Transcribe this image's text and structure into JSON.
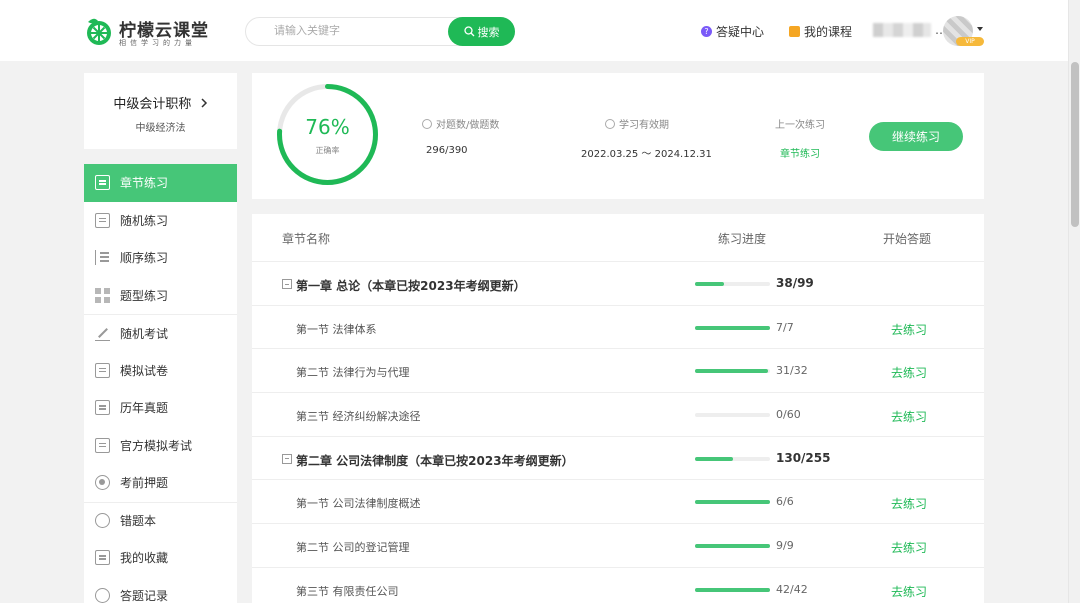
{
  "header": {
    "logo_title": "柠檬云课堂",
    "logo_sub": "相信学习的力量",
    "search_placeholder": "请输入关键字",
    "search_button": "搜索",
    "qa_center": "答疑中心",
    "my_courses": "我的课程",
    "user_name_partial": "…",
    "vip_badge": "VIP"
  },
  "sidebar": {
    "course_title": "中级会计职称",
    "course_subject": "中级经济法",
    "menu": [
      {
        "label": "章节练习",
        "icon": "chapter-icon",
        "active": true
      },
      {
        "label": "随机练习",
        "icon": "random-icon"
      },
      {
        "label": "顺序练习",
        "icon": "sequence-icon"
      },
      {
        "label": "题型练习",
        "icon": "question-type-icon"
      },
      {
        "label": "随机考试",
        "icon": "exam-pen-icon"
      },
      {
        "label": "模拟试卷",
        "icon": "mock-paper-icon"
      },
      {
        "label": "历年真题",
        "icon": "past-papers-icon"
      },
      {
        "label": "官方模拟考试",
        "icon": "official-mock-icon"
      },
      {
        "label": "考前押题",
        "icon": "predict-icon"
      },
      {
        "label": "错题本",
        "icon": "wrong-book-icon"
      },
      {
        "label": "我的收藏",
        "icon": "favorites-icon"
      },
      {
        "label": "答题记录",
        "icon": "history-icon"
      }
    ]
  },
  "stats": {
    "accuracy_pct": "76%",
    "accuracy_value": 0.76,
    "accuracy_label": "正确率",
    "correct_label": "对题数/做题数",
    "correct_value": "296/390",
    "validity_label": "学习有效期",
    "validity_value": "2022.03.25 ～ 2024.12.31",
    "last_label": "上一次练习",
    "last_value": "章节练习",
    "continue_button": "继续练习",
    "accent_color": "#1fb956"
  },
  "table": {
    "col_name": "章节名称",
    "col_progress": "练习进度",
    "col_start": "开始答题",
    "go_label": "去练习",
    "rows": [
      {
        "type": "chapter",
        "name": "第一章 总论（本章已按2023年考纲更新）",
        "count": "38/99",
        "progress": 0.384
      },
      {
        "type": "section",
        "name": "第一节 法律体系",
        "count": "7/7",
        "progress": 1.0
      },
      {
        "type": "section",
        "name": "第二节 法律行为与代理",
        "count": "31/32",
        "progress": 0.97
      },
      {
        "type": "section",
        "name": "第三节 经济纠纷解决途径",
        "count": "0/60",
        "progress": 0.0
      },
      {
        "type": "chapter",
        "name": "第二章 公司法律制度（本章已按2023年考纲更新）",
        "count": "130/255",
        "progress": 0.51
      },
      {
        "type": "section",
        "name": "第一节 公司法律制度概述",
        "count": "6/6",
        "progress": 1.0
      },
      {
        "type": "section",
        "name": "第二节 公司的登记管理",
        "count": "9/9",
        "progress": 1.0
      },
      {
        "type": "section",
        "name": "第三节 有限责任公司",
        "count": "42/42",
        "progress": 1.0
      }
    ]
  }
}
